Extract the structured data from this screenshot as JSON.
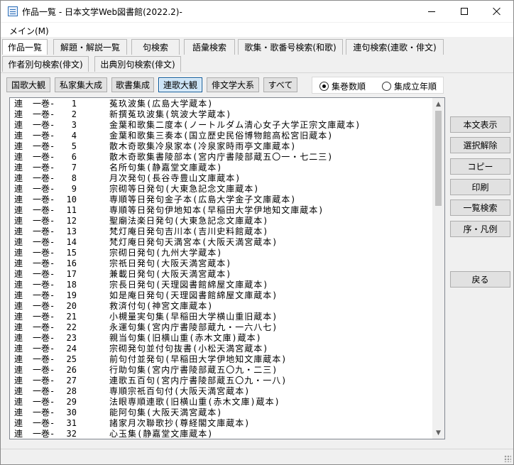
{
  "window": {
    "title": "作品一覧 - 日本文学Web図書館(2022.2)-",
    "icons": {
      "app": "app-icon",
      "minimize": "minimize-icon",
      "maximize": "maximize-icon",
      "close": "close-icon"
    }
  },
  "menu": {
    "items": [
      "メイン(M)"
    ]
  },
  "tabs_row1": [
    {
      "label": "作品一覧",
      "active": true
    },
    {
      "label": "解題・解説一覧",
      "active": false
    },
    {
      "label": "句検索",
      "active": false
    },
    {
      "label": "語彙検索",
      "active": false
    },
    {
      "label": "歌集・歌番号検索(和歌)",
      "active": false
    },
    {
      "label": "連句検索(連歌・俳文)",
      "active": false
    }
  ],
  "tabs_row2": [
    {
      "label": "作者別句検索(俳文)",
      "active": false
    },
    {
      "label": "出典別句検索(俳文)",
      "active": false
    }
  ],
  "collection_buttons": [
    {
      "label": "国歌大観",
      "pressed": false
    },
    {
      "label": "私家集大成",
      "pressed": false
    },
    {
      "label": "歌書集成",
      "pressed": false
    },
    {
      "label": "連歌大観",
      "pressed": true
    },
    {
      "label": "俳文学大系",
      "pressed": false
    },
    {
      "label": "すべて",
      "pressed": false
    }
  ],
  "sort_options": [
    {
      "label": "集巻数順",
      "checked": true
    },
    {
      "label": "集成立年順",
      "checked": false
    }
  ],
  "list": [
    {
      "cat": "連",
      "vol": "一巻-",
      "num": "1",
      "title": "菟玖波集(広島大学蔵本)"
    },
    {
      "cat": "連",
      "vol": "一巻-",
      "num": "2",
      "title": "新撰菟玖波集(筑波大学蔵本)"
    },
    {
      "cat": "連",
      "vol": "一巻-",
      "num": "3",
      "title": "金葉和歌集二度本(ノートルダム清心女子大学正宗文庫蔵本)"
    },
    {
      "cat": "連",
      "vol": "一巻-",
      "num": "4",
      "title": "金葉和歌集三奏本(国立歴史民俗博物館高松宮旧蔵本)"
    },
    {
      "cat": "連",
      "vol": "一巻-",
      "num": "5",
      "title": "散木奇歌集冷泉家本(冷泉家時雨亭文庫蔵本)"
    },
    {
      "cat": "連",
      "vol": "一巻-",
      "num": "6",
      "title": "散木奇歌集書陵部本(宮内庁書陵部蔵五〇一・七二三)"
    },
    {
      "cat": "連",
      "vol": "一巻-",
      "num": "7",
      "title": "名所句集(静嘉堂文庫蔵本)"
    },
    {
      "cat": "連",
      "vol": "一巻-",
      "num": "8",
      "title": "月次発句(長谷寺豊山文庫蔵本)"
    },
    {
      "cat": "連",
      "vol": "一巻-",
      "num": "9",
      "title": "宗砌等日発句(大東急記念文庫蔵本)"
    },
    {
      "cat": "連",
      "vol": "一巻-",
      "num": "10",
      "title": "専順等日発句金子本(広島大学金子文庫蔵本)"
    },
    {
      "cat": "連",
      "vol": "一巻-",
      "num": "11",
      "title": "専順等日発句伊地知本(早稲田大学伊地知文庫蔵本)"
    },
    {
      "cat": "連",
      "vol": "一巻-",
      "num": "12",
      "title": "聖廟法楽日発句(大東急記念文庫蔵本)"
    },
    {
      "cat": "連",
      "vol": "一巻-",
      "num": "13",
      "title": "梵灯庵日発句吉川本(吉川史料館蔵本)"
    },
    {
      "cat": "連",
      "vol": "一巻-",
      "num": "14",
      "title": "梵灯庵日発句天満宮本(大阪天満宮蔵本)"
    },
    {
      "cat": "連",
      "vol": "一巻-",
      "num": "15",
      "title": "宗砌日発句(九州大学蔵本)"
    },
    {
      "cat": "連",
      "vol": "一巻-",
      "num": "16",
      "title": "宗祇日発句(大阪天満宮蔵本)"
    },
    {
      "cat": "連",
      "vol": "一巻-",
      "num": "17",
      "title": "兼載日発句(大阪天満宮蔵本)"
    },
    {
      "cat": "連",
      "vol": "一巻-",
      "num": "18",
      "title": "宗長日発句(天理図書館綿屋文庫蔵本)"
    },
    {
      "cat": "連",
      "vol": "一巻-",
      "num": "19",
      "title": "如是庵日発句(天理図書館綿屋文庫蔵本)"
    },
    {
      "cat": "連",
      "vol": "一巻-",
      "num": "20",
      "title": "救済付句(神宮文庫蔵本)"
    },
    {
      "cat": "連",
      "vol": "一巻-",
      "num": "21",
      "title": "小槻量実句集(早稲田大学横山重旧蔵本)"
    },
    {
      "cat": "連",
      "vol": "一巻-",
      "num": "22",
      "title": "永運句集(宮内庁書陵部蔵九・一六八七)"
    },
    {
      "cat": "連",
      "vol": "一巻-",
      "num": "23",
      "title": "親当句集(旧横山重(赤木文庫)蔵本)"
    },
    {
      "cat": "連",
      "vol": "一巻-",
      "num": "24",
      "title": "宗砌発句並付句抜書(小松天満宮蔵本)"
    },
    {
      "cat": "連",
      "vol": "一巻-",
      "num": "25",
      "title": "前句付並発句(早稲田大学伊地知文庫蔵本)"
    },
    {
      "cat": "連",
      "vol": "一巻-",
      "num": "26",
      "title": "行助句集(宮内庁書陵部蔵五〇九・二三)"
    },
    {
      "cat": "連",
      "vol": "一巻-",
      "num": "27",
      "title": "連歌五百句(宮内庁書陵部蔵五〇九・一八)"
    },
    {
      "cat": "連",
      "vol": "一巻-",
      "num": "28",
      "title": "専順宗祇百句付(大阪天満宮蔵本)"
    },
    {
      "cat": "連",
      "vol": "一巻-",
      "num": "29",
      "title": "法眼専順連歌(旧横山重(赤木文庫)蔵本)"
    },
    {
      "cat": "連",
      "vol": "一巻-",
      "num": "30",
      "title": "能阿句集(大阪天満宮蔵本)"
    },
    {
      "cat": "連",
      "vol": "一巻-",
      "num": "31",
      "title": "諸家月次聯歌抄(尊経閣文庫蔵本)"
    },
    {
      "cat": "連",
      "vol": "一巻-",
      "num": "32",
      "title": "心玉集(静嘉堂文庫蔵本)"
    }
  ],
  "side_buttons": [
    "本文表示",
    "選択解除",
    "コピー",
    "印刷",
    "一覧検索",
    "序・凡例",
    "戻る"
  ]
}
